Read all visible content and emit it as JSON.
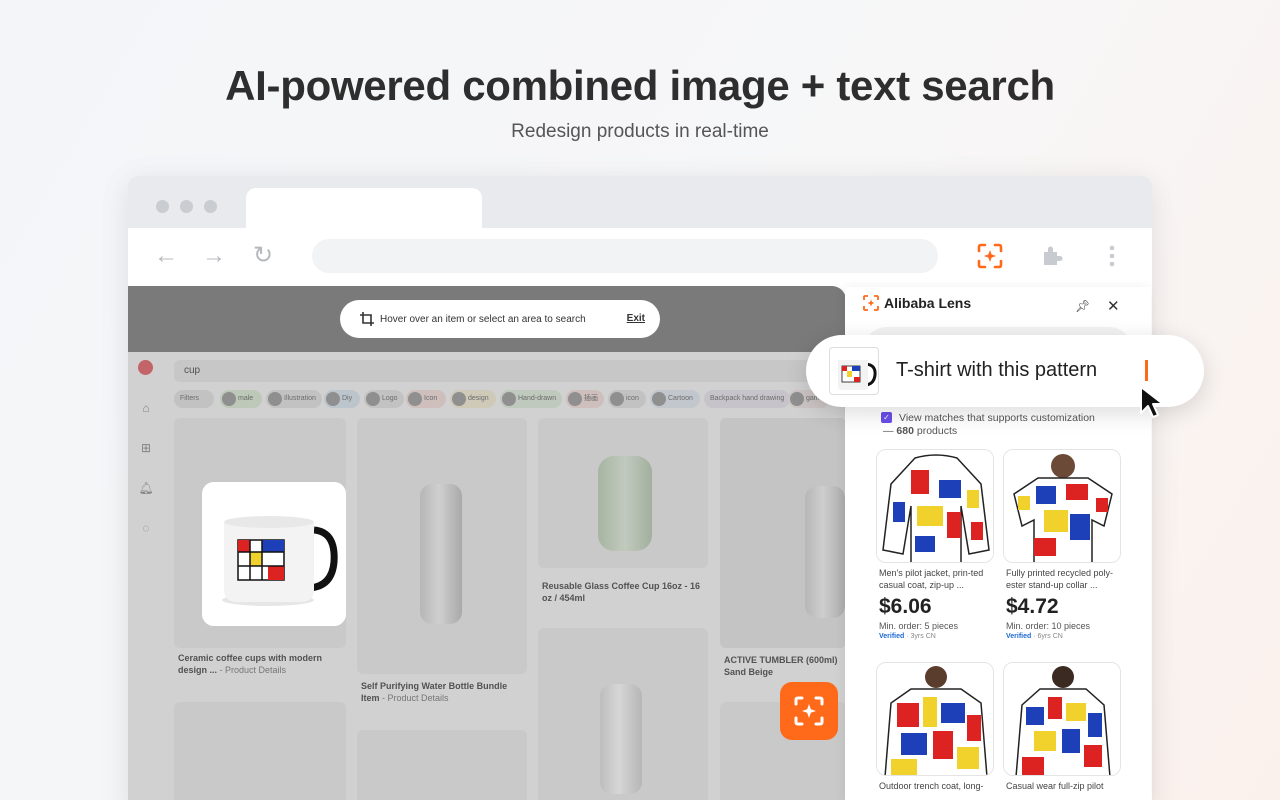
{
  "hero": {
    "title": "AI-powered combined image + text search",
    "subtitle": "Redesign products in real-time"
  },
  "browser": {
    "hint": "Hover over an item or select an area to search",
    "exit_label": "Exit",
    "accent_color": "#ff6a1a"
  },
  "site": {
    "search_query": "cup",
    "chips": [
      "Filters",
      "male",
      "Illustration",
      "Diy",
      "Logo",
      "Icon",
      "design",
      "Hand-drawn",
      "插画",
      "icon",
      "Cartoon",
      "Backpack hand drawing",
      "game"
    ],
    "cards": [
      {
        "title": "Ceramic coffee cups with modern design ...",
        "suffix": " - Product Details"
      },
      {
        "title": "Self Purifying Water Bottle Bundle Item",
        "suffix": " - Product Details"
      },
      {
        "title": "Reusable Glass Coffee Cup 16oz - 16 oz / 454ml",
        "suffix": ""
      },
      {
        "title": "ACTIVE TUMBLER (600ml) Sand Beige",
        "suffix": ""
      }
    ]
  },
  "panel": {
    "brand": "Alibaba Lens",
    "query": "T-shirt with this pattern",
    "match_text": "View matches that supports customization",
    "match_count_prefix": "— ",
    "match_count": "680",
    "match_count_suffix": " products",
    "products": [
      {
        "title": "Men's pilot jacket, prin-ted casual coat, zip-up ...",
        "price": "$6.06",
        "moq": "Min. order: 5 pieces",
        "verified": "Verified",
        "supplier": "3yrs CN"
      },
      {
        "title": "Fully printed recycled poly-ester stand-up collar ...",
        "price": "$4.72",
        "moq": "Min. order: 10 pieces",
        "verified": "Verified",
        "supplier": "6yrs CN"
      },
      {
        "title": "Outdoor trench coat, long-",
        "price": "",
        "moq": "",
        "verified": "",
        "supplier": ""
      },
      {
        "title": "Casual wear full-zip pilot",
        "price": "",
        "moq": "",
        "verified": "",
        "supplier": ""
      }
    ]
  }
}
